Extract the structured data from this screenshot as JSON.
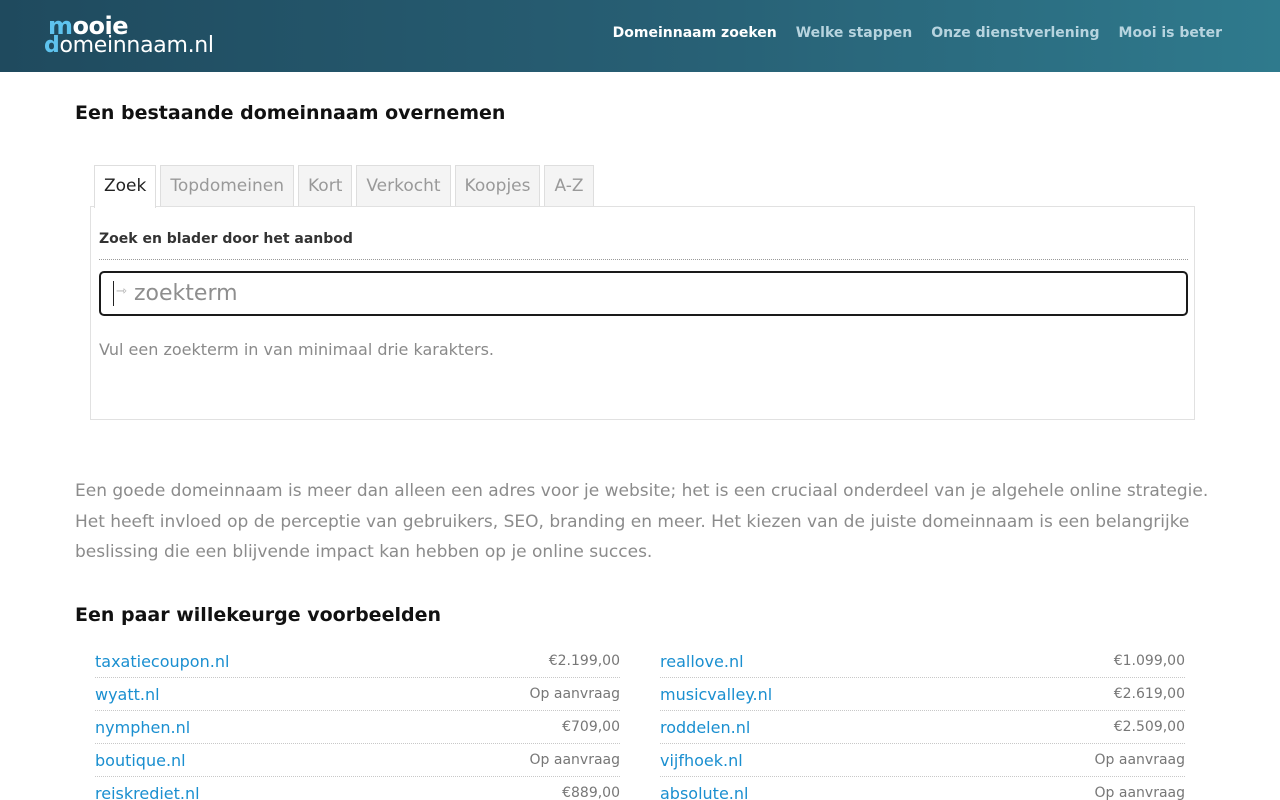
{
  "header": {
    "logo": {
      "line1_accent": "m",
      "line1_rest": "ooie",
      "line2_accent": "d",
      "line2_rest": "omeinnaam.nl"
    },
    "nav": [
      {
        "label": "Domeinnaam zoeken",
        "active": true
      },
      {
        "label": "Welke stappen",
        "active": false
      },
      {
        "label": "Onze dienstverlening",
        "active": false
      },
      {
        "label": "Mooi is beter",
        "active": false
      }
    ]
  },
  "main": {
    "title": "Een bestaande domeinnaam overnemen",
    "tabs": [
      "Zoek",
      "Topdomeinen",
      "Kort",
      "Verkocht",
      "Koopjes",
      "A-Z"
    ],
    "panel": {
      "heading": "Zoek en blader door het aanbod",
      "search_placeholder": "zoekterm",
      "search_value": "",
      "hint": "Vul een zoekterm in van minimaal drie karakters."
    },
    "intro": "Een goede domeinnaam is meer dan alleen een adres voor je website; het is een cruciaal onderdeel van je algehele online strategie. Het heeft invloed op de perceptie van gebruikers, SEO, branding en meer. Het kiezen van de juiste domeinnaam is een belangrijke beslissing die een blijvende impact kan hebben op je online succes.",
    "examples_title": "Een paar willekeurge voorbeelden",
    "examples_left": [
      {
        "domain": "taxatiecoupon.nl",
        "price": "€2.199,00"
      },
      {
        "domain": "wyatt.nl",
        "price": "Op aanvraag"
      },
      {
        "domain": "nymphen.nl",
        "price": "€709,00"
      },
      {
        "domain": "boutique.nl",
        "price": "Op aanvraag"
      },
      {
        "domain": "reiskrediet.nl",
        "price": "€889,00"
      }
    ],
    "examples_right": [
      {
        "domain": "reallove.nl",
        "price": "€1.099,00"
      },
      {
        "domain": "musicvalley.nl",
        "price": "€2.619,00"
      },
      {
        "domain": "roddelen.nl",
        "price": "€2.509,00"
      },
      {
        "domain": "vijfhoek.nl",
        "price": "Op aanvraag"
      },
      {
        "domain": "absolute.nl",
        "price": "Op aanvraag"
      }
    ]
  },
  "colors": {
    "header_start": "#1f4a5e",
    "header_end": "#2f7a8d",
    "logo_accent": "#5ec3ee",
    "link": "#1a8fd0"
  },
  "icons": {
    "search_prefix": "arrow-right-icon"
  }
}
